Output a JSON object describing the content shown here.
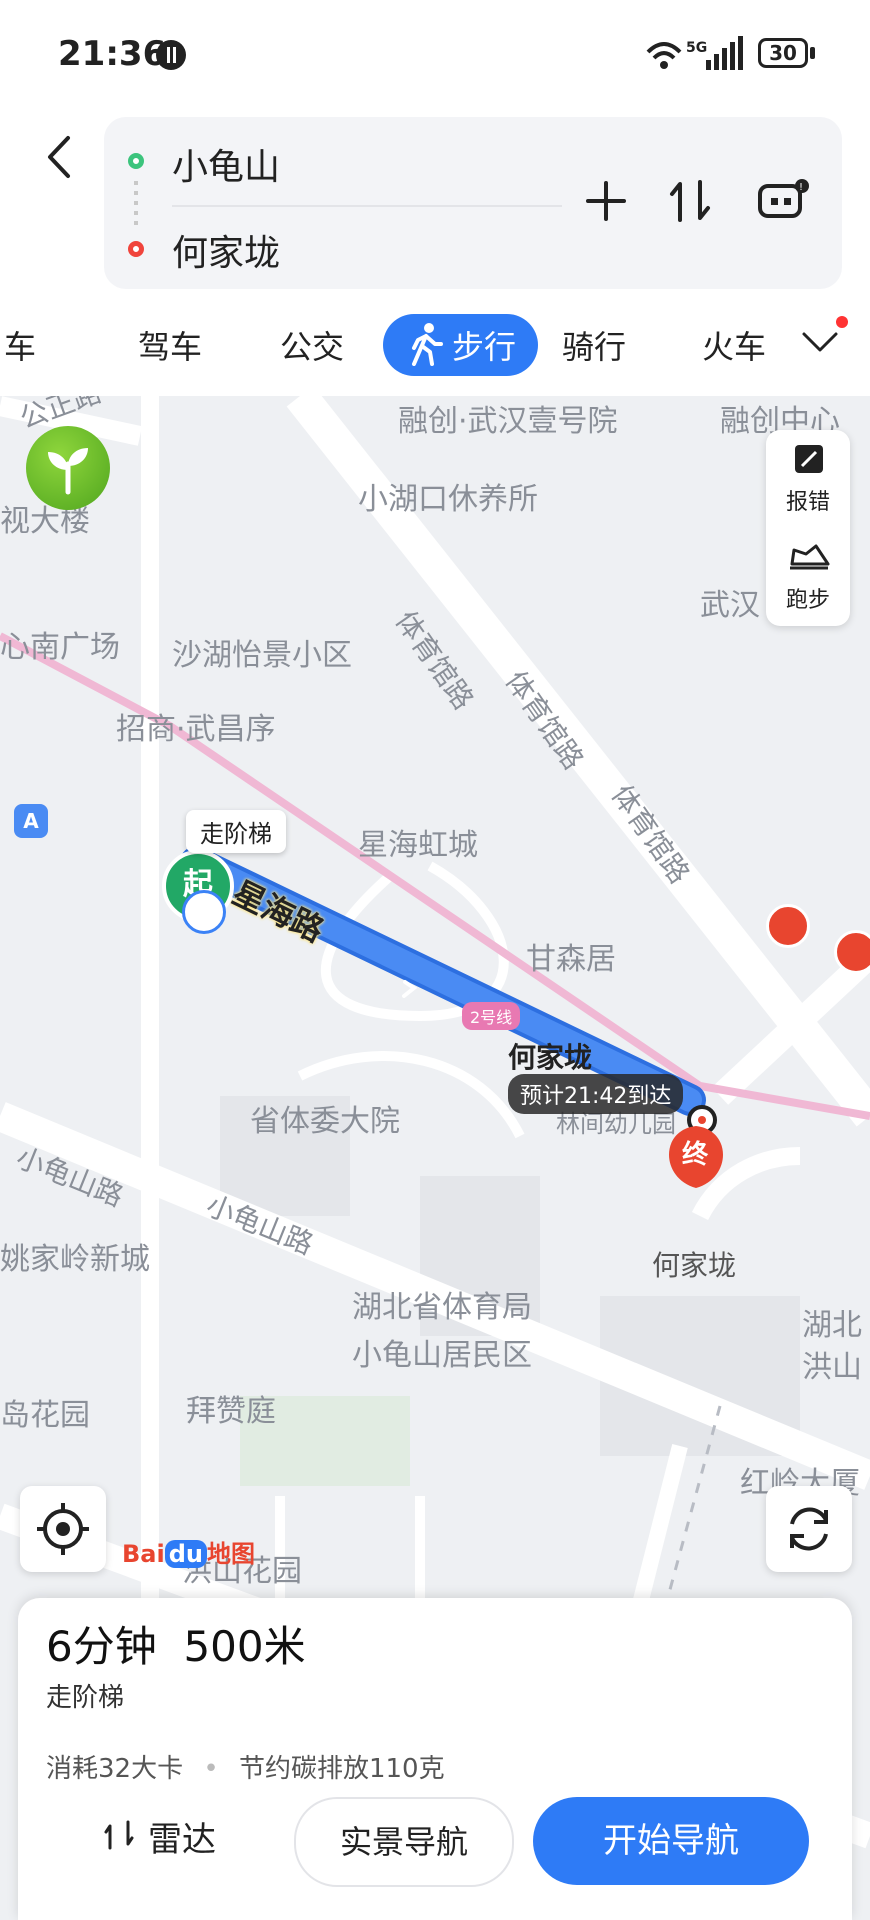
{
  "status_bar": {
    "time": "21:36",
    "network": "5G",
    "battery": "30"
  },
  "route": {
    "from": "小龟山",
    "to": "何家垅"
  },
  "tabs": {
    "items": [
      "打车",
      "驾车",
      "公交",
      "步行",
      "骑行",
      "火车"
    ],
    "visible_partial_first": "车",
    "active": "步行"
  },
  "map": {
    "place_labels": {
      "rongchuang_yihao": "融创·武汉壹号院",
      "rongchuang_center": "融创中心",
      "xiaohukou": "小湖口休养所",
      "shahu_yijing": "沙湖怡景小区",
      "zhaoshang": "招商·武昌序",
      "xinghai_hongcheng": "星海虹城",
      "gansenju": "甘森居",
      "sheng_tiwei": "省体委大院",
      "hubei_tiyuju": "湖北省体育局",
      "xiaoguishan_juminqu": "小龟山居民区",
      "baizanting": "拜赞庭",
      "hongshan_huayuan": "洪山花园",
      "yaojialing": "姚家岭新城",
      "dao_huayuan": "岛花园",
      "shi_dalou": "视大楼",
      "xin_guangchang": "心南广场",
      "wuhan_partial": "武汉",
      "hubei_hongshan_1": "湖北",
      "hubei_hongshan_2": "洪山",
      "hongling": "红岭大厦",
      "linjie": "林间幼儿园"
    },
    "road_labels": {
      "tiyuguan_1": "体育馆路",
      "tiyuguan_2": "体育馆路",
      "tiyuguan_3": "体育馆路",
      "xiaoguishan_1": "小龟山路",
      "xiaoguishan_2": "小龟山路",
      "gongzheng": "公正路",
      "xinghai": "星海路"
    },
    "metro_line": "2号线",
    "start_marker": "起",
    "start_callout": "走阶梯",
    "end_marker": "终",
    "end_label": "何家垅",
    "hejialong_station": "何家垅",
    "eta": "预计21:42到达",
    "side_tools": {
      "report": "报错",
      "run": "跑步"
    },
    "logo": "Bai地图"
  },
  "summary": {
    "duration": "6分钟",
    "distance": "500米",
    "subtitle": "走阶梯",
    "calories": "消耗32大卡",
    "carbon": "节约碳排放110克"
  },
  "actions": {
    "radar": "雷达",
    "ar_nav": "实景导航",
    "start_nav": "开始导航"
  },
  "colors": {
    "accent": "#2e7bf6",
    "start_green": "#22a866",
    "end_red": "#e8452f",
    "route_blue": "#3b82f6"
  }
}
